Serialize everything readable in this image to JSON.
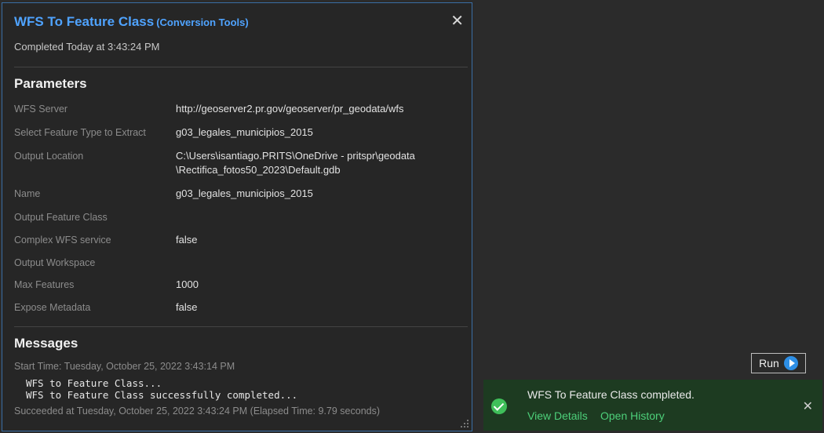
{
  "header": {
    "tool_name": "WFS To Feature Class",
    "toolbox": "(Conversion Tools)",
    "completed": "Completed Today at 3:43:24 PM",
    "close": "✕"
  },
  "parameters": {
    "title": "Parameters",
    "rows": [
      {
        "label": "WFS Server",
        "value": "http://geoserver2.pr.gov/geoserver/pr_geodata/wfs"
      },
      {
        "label": "Select Feature Type to Extract",
        "value": "g03_legales_municipios_2015"
      },
      {
        "label": "Output Location",
        "value": "C:\\Users\\isantiago.PRITS\\OneDrive - pritspr\\geodata",
        "value2": "\\Rectifica_fotos50_2023\\Default.gdb"
      },
      {
        "label": "Name",
        "value": "g03_legales_municipios_2015"
      },
      {
        "label": "Output Feature Class",
        "value": ""
      },
      {
        "label": "Complex WFS service",
        "value": "false"
      },
      {
        "label": "Output Workspace",
        "value": ""
      },
      {
        "label": "Max Features",
        "value": "1000"
      },
      {
        "label": "Expose Metadata",
        "value": "false"
      }
    ]
  },
  "messages": {
    "title": "Messages",
    "start": "Start Time: Tuesday, October 25, 2022 3:43:14 PM",
    "line1": "WFS to Feature Class...",
    "line2": "WFS to Feature Class successfully completed...",
    "end": "Succeeded at Tuesday, October 25, 2022 3:43:24 PM (Elapsed Time: 9.79 seconds)"
  },
  "run_button": {
    "label": "Run",
    "icon": "play-icon"
  },
  "toast": {
    "message": "WFS To Feature Class completed.",
    "view_details": "View Details",
    "open_history": "Open History",
    "close": "✕",
    "icon": "check-circle-icon"
  },
  "colors": {
    "accent": "#4fa3ff",
    "success": "#3fbf5a",
    "toast_bg": "#1d3b21",
    "link": "#4dd07a"
  }
}
